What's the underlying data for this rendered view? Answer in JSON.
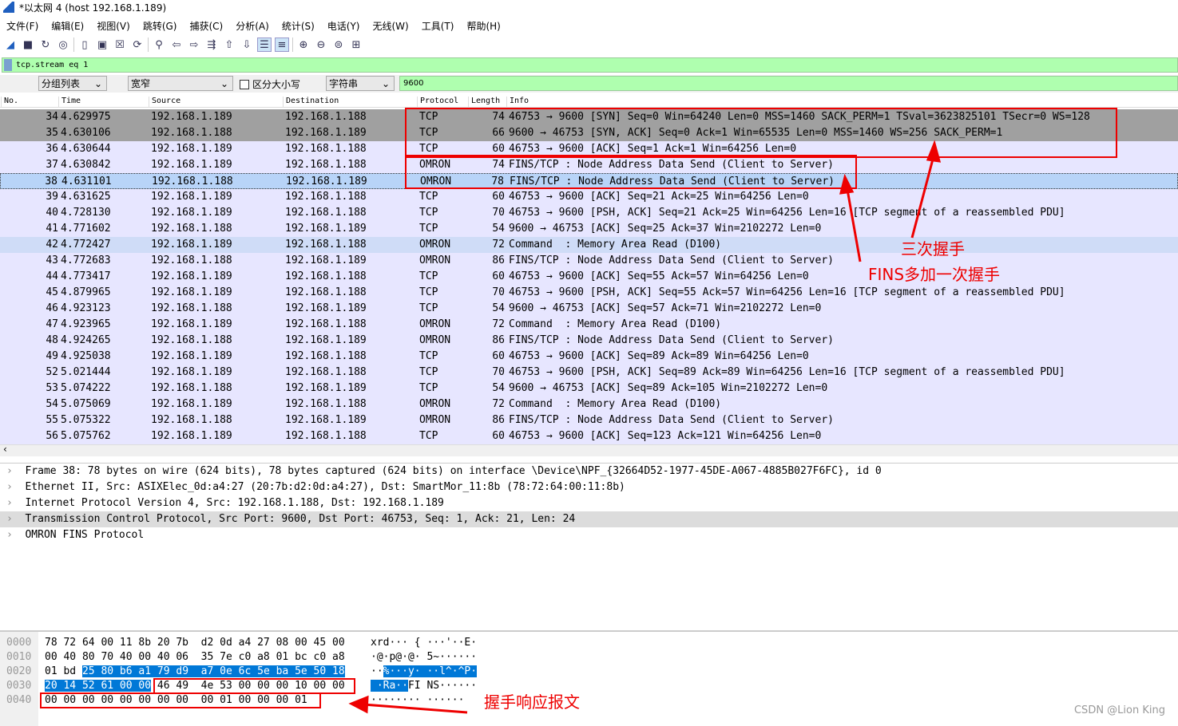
{
  "window": {
    "title": "*以太网 4 (host 192.168.1.189)"
  },
  "menu": [
    "文件(F)",
    "编辑(E)",
    "视图(V)",
    "跳转(G)",
    "捕获(C)",
    "分析(A)",
    "统计(S)",
    "电话(Y)",
    "无线(W)",
    "工具(T)",
    "帮助(H)"
  ],
  "toolbar": [
    "shark-fin-icon",
    "stop-icon",
    "restart-icon",
    "options-icon",
    "open-icon",
    "save-icon",
    "close-icon",
    "reload-icon",
    "find-icon",
    "back-icon",
    "forward-icon",
    "goto-icon",
    "first-icon",
    "last-icon",
    "autoscroll-icon",
    "colorize-icon",
    "zoom-in-icon",
    "zoom-out-icon",
    "zoom-reset-icon",
    "resize-columns-icon"
  ],
  "filter": {
    "value": "tcp.stream eq 1"
  },
  "find": {
    "scope": "分组列表",
    "charset": "宽窄",
    "case_label": "区分大小写",
    "type": "字符串",
    "value": "9600"
  },
  "columns": [
    "No.",
    "Time",
    "Source",
    "Destination",
    "Protocol",
    "Length",
    "Info"
  ],
  "packets": [
    [
      "34",
      "4.629975",
      "192.168.1.189",
      "192.168.1.188",
      "TCP",
      "74",
      "46753 → 9600 [SYN] Seq=0 Win=64240 Len=0 MSS=1460 SACK_PERM=1 TSval=3623825101 TSecr=0 WS=128"
    ],
    [
      "35",
      "4.630106",
      "192.168.1.188",
      "192.168.1.189",
      "TCP",
      "66",
      "9600 → 46753 [SYN, ACK] Seq=0 Ack=1 Win=65535 Len=0 MSS=1460 WS=256 SACK_PERM=1"
    ],
    [
      "36",
      "4.630644",
      "192.168.1.189",
      "192.168.1.188",
      "TCP",
      "60",
      "46753 → 9600 [ACK] Seq=1 Ack=1 Win=64256 Len=0"
    ],
    [
      "37",
      "4.630842",
      "192.168.1.189",
      "192.168.1.188",
      "OMRON",
      "74",
      "FINS/TCP : Node Address Data Send (Client to Server)"
    ],
    [
      "38",
      "4.631101",
      "192.168.1.188",
      "192.168.1.189",
      "OMRON",
      "78",
      "FINS/TCP : Node Address Data Send (Client to Server)"
    ],
    [
      "39",
      "4.631625",
      "192.168.1.189",
      "192.168.1.188",
      "TCP",
      "60",
      "46753 → 9600 [ACK] Seq=21 Ack=25 Win=64256 Len=0"
    ],
    [
      "40",
      "4.728130",
      "192.168.1.189",
      "192.168.1.188",
      "TCP",
      "70",
      "46753 → 9600 [PSH, ACK] Seq=21 Ack=25 Win=64256 Len=16 [TCP segment of a reassembled PDU]"
    ],
    [
      "41",
      "4.771602",
      "192.168.1.188",
      "192.168.1.189",
      "TCP",
      "54",
      "9600 → 46753 [ACK] Seq=25 Ack=37 Win=2102272 Len=0"
    ],
    [
      "42",
      "4.772427",
      "192.168.1.189",
      "192.168.1.188",
      "OMRON",
      "72",
      "Command  : Memory Area Read (D100)"
    ],
    [
      "43",
      "4.772683",
      "192.168.1.188",
      "192.168.1.189",
      "OMRON",
      "86",
      "FINS/TCP : Node Address Data Send (Client to Server)"
    ],
    [
      "44",
      "4.773417",
      "192.168.1.189",
      "192.168.1.188",
      "TCP",
      "60",
      "46753 → 9600 [ACK] Seq=55 Ack=57 Win=64256 Len=0"
    ],
    [
      "45",
      "4.879965",
      "192.168.1.189",
      "192.168.1.188",
      "TCP",
      "70",
      "46753 → 9600 [PSH, ACK] Seq=55 Ack=57 Win=64256 Len=16 [TCP segment of a reassembled PDU]"
    ],
    [
      "46",
      "4.923123",
      "192.168.1.188",
      "192.168.1.189",
      "TCP",
      "54",
      "9600 → 46753 [ACK] Seq=57 Ack=71 Win=2102272 Len=0"
    ],
    [
      "47",
      "4.923965",
      "192.168.1.189",
      "192.168.1.188",
      "OMRON",
      "72",
      "Command  : Memory Area Read (D100)"
    ],
    [
      "48",
      "4.924265",
      "192.168.1.188",
      "192.168.1.189",
      "OMRON",
      "86",
      "FINS/TCP : Node Address Data Send (Client to Server)"
    ],
    [
      "49",
      "4.925038",
      "192.168.1.189",
      "192.168.1.188",
      "TCP",
      "60",
      "46753 → 9600 [ACK] Seq=89 Ack=89 Win=64256 Len=0"
    ],
    [
      "52",
      "5.021444",
      "192.168.1.189",
      "192.168.1.188",
      "TCP",
      "70",
      "46753 → 9600 [PSH, ACK] Seq=89 Ack=89 Win=64256 Len=16 [TCP segment of a reassembled PDU]"
    ],
    [
      "53",
      "5.074222",
      "192.168.1.188",
      "192.168.1.189",
      "TCP",
      "54",
      "9600 → 46753 [ACK] Seq=89 Ack=105 Win=2102272 Len=0"
    ],
    [
      "54",
      "5.075069",
      "192.168.1.189",
      "192.168.1.188",
      "OMRON",
      "72",
      "Command  : Memory Area Read (D100)"
    ],
    [
      "55",
      "5.075322",
      "192.168.1.188",
      "192.168.1.189",
      "OMRON",
      "86",
      "FINS/TCP : Node Address Data Send (Client to Server)"
    ],
    [
      "56",
      "5.075762",
      "192.168.1.189",
      "192.168.1.188",
      "TCP",
      "60",
      "46753 → 9600 [ACK] Seq=123 Ack=121 Win=64256 Len=0"
    ]
  ],
  "details": [
    "Frame 38: 78 bytes on wire (624 bits), 78 bytes captured (624 bits) on interface \\Device\\NPF_{32664D52-1977-45DE-A067-4885B027F6FC}, id 0",
    "Ethernet II, Src: ASIXElec_0d:a4:27 (20:7b:d2:0d:a4:27), Dst: SmartMor_11:8b (78:72:64:00:11:8b)",
    "Internet Protocol Version 4, Src: 192.168.1.188, Dst: 192.168.1.189",
    "Transmission Control Protocol, Src Port: 9600, Dst Port: 46753, Seq: 1, Ack: 21, Len: 24",
    "OMRON FINS Protocol"
  ],
  "hex": [
    {
      "off": "0000",
      "a": "78 72 64 00 11 8b 20 7b  d2 0d a4 27 08 00 45 00",
      "b": "",
      "c": "",
      "asc1": "xrd··· { ···'··E·",
      "asc2": "",
      "asc3": ""
    },
    {
      "off": "0010",
      "a": "00 40 80 70 40 00 40 06  35 7e c0 a8 01 bc c0 a8",
      "b": "",
      "c": "",
      "asc1": "·@·p@·@· 5~······",
      "asc2": "",
      "asc3": ""
    },
    {
      "off": "0020",
      "a": "01 bd ",
      "b": "25 80 b6 a1 79 d9  a7 0e 6c 5e ba 5e 50 18",
      "c": "",
      "asc1": "··",
      "asc2": "%···y· ··l^·^P·",
      "asc3": ""
    },
    {
      "off": "0030",
      "a": "",
      "b": "20 14 52 61 00 00",
      "c": " 46 49  4e 53 00 00 00 10 00 00",
      "asc1": "",
      "asc2": " ·Ra··",
      "asc3": "FI NS······"
    },
    {
      "off": "0040",
      "a": "00 00 00 00 00 00 00 00  00 01 00 00 00 01",
      "b": "",
      "c": "",
      "asc1": "········ ······",
      "asc2": "",
      "asc3": ""
    }
  ],
  "annotations": {
    "handshake": "三次握手",
    "fins_handshake": "FINS多加一次握手",
    "response": "握手响应报文",
    "color": "#e00000"
  },
  "watermark": "CSDN @Lion King"
}
